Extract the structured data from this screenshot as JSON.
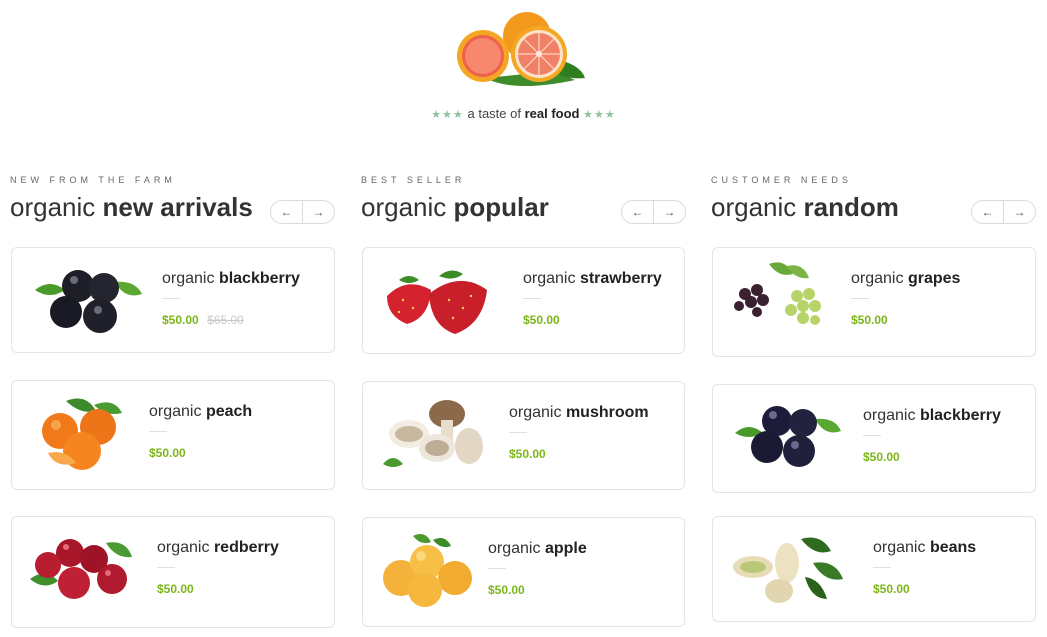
{
  "hero": {
    "image_icon": "grapefruit-icon",
    "stars_left": "★★★",
    "tagline_prefix": "a taste of",
    "tagline_bold": "real food",
    "stars_right": "★★★"
  },
  "columns": [
    {
      "subtitle": "NEW FROM THE FARM",
      "title_light": "organic",
      "title_bold": "new arrivals",
      "prev_label": "←",
      "next_label": "→",
      "products": [
        {
          "prefix": "organic",
          "name": "blackberry",
          "price": "$50.00",
          "old_price": "$65.00",
          "icon": "blackberry-icon"
        },
        {
          "prefix": "organic",
          "name": "peach",
          "price": "$50.00",
          "icon": "peach-icon"
        },
        {
          "prefix": "organic",
          "name": "redberry",
          "price": "$50.00",
          "icon": "redberry-icon"
        }
      ]
    },
    {
      "subtitle": "BEST SELLER",
      "title_light": "organic",
      "title_bold": "popular",
      "prev_label": "←",
      "next_label": "→",
      "products": [
        {
          "prefix": "organic",
          "name": "strawberry",
          "price": "$50.00",
          "icon": "strawberry-icon"
        },
        {
          "prefix": "organic",
          "name": "mushroom",
          "price": "$50.00",
          "icon": "mushroom-icon"
        },
        {
          "prefix": "organic",
          "name": "apple",
          "price": "$50.00",
          "icon": "apple-icon"
        }
      ]
    },
    {
      "subtitle": "CUSTOMER NEEDS",
      "title_light": "organic",
      "title_bold": "random",
      "prev_label": "←",
      "next_label": "→",
      "products": [
        {
          "prefix": "organic",
          "name": "grapes",
          "price": "$50.00",
          "icon": "grapes-icon"
        },
        {
          "prefix": "organic",
          "name": "blackberry",
          "price": "$50.00",
          "icon": "blackberry-icon"
        },
        {
          "prefix": "organic",
          "name": "beans",
          "price": "$50.00",
          "icon": "beans-icon"
        }
      ]
    }
  ],
  "colors": {
    "price": "#7cb518",
    "star": "#8fc29a",
    "border": "#e4e4e4"
  }
}
